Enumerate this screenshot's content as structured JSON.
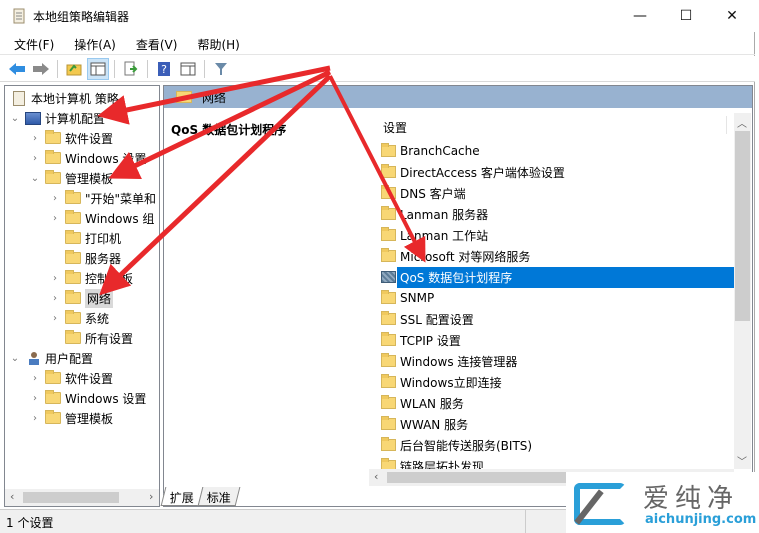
{
  "window": {
    "title": "本地组策略编辑器",
    "controls": {
      "minimize": "—",
      "maximize": "☐",
      "close": "✕"
    }
  },
  "menubar": {
    "items": [
      "文件(F)",
      "操作(A)",
      "查看(V)",
      "帮助(H)"
    ]
  },
  "toolbar": {
    "buttons": [
      "back-icon",
      "forward-icon",
      "up-folder-icon",
      "show-hide-tree-icon",
      "export-list-icon",
      "help-icon",
      "show-action-pane-icon",
      "filter-icon"
    ]
  },
  "tree": {
    "root": "本地计算机 策略",
    "computer_config": "计算机配置",
    "software_settings": "软件设置",
    "windows_settings": "Windows 设置",
    "admin_templates": "管理模板",
    "start_menu": "\"开始\"菜单和",
    "windows_components": "Windows 组",
    "printers": "打印机",
    "server": "服务器",
    "control_panel": "控制面板",
    "network": "网络",
    "system": "系统",
    "all_settings": "所有设置",
    "user_config": "用户配置",
    "user_software_settings": "软件设置",
    "user_windows_settings": "Windows 设置",
    "user_admin_templates": "管理模板"
  },
  "right_pane": {
    "header": "网络",
    "description_title": "QoS 数据包计划程序",
    "column_header": "设置",
    "items": [
      {
        "label": "BranchCache",
        "type": "folder"
      },
      {
        "label": "DirectAccess 客户端体验设置",
        "type": "folder"
      },
      {
        "label": "DNS 客户端",
        "type": "folder"
      },
      {
        "label": "Lanman 服务器",
        "type": "folder"
      },
      {
        "label": "Lanman 工作站",
        "type": "folder"
      },
      {
        "label": "Microsoft 对等网络服务",
        "type": "folder"
      },
      {
        "label": "QoS 数据包计划程序",
        "type": "policy",
        "selected": true
      },
      {
        "label": "SNMP",
        "type": "folder"
      },
      {
        "label": "SSL 配置设置",
        "type": "folder"
      },
      {
        "label": "TCPIP 设置",
        "type": "folder"
      },
      {
        "label": "Windows 连接管理器",
        "type": "folder"
      },
      {
        "label": "Windows立即连接",
        "type": "folder"
      },
      {
        "label": "WLAN 服务",
        "type": "folder"
      },
      {
        "label": "WWAN 服务",
        "type": "folder"
      },
      {
        "label": "后台智能传送服务(BITS)",
        "type": "folder"
      },
      {
        "label": "链路层拓扑发现",
        "type": "folder"
      }
    ]
  },
  "tabs": [
    "扩展",
    "标准"
  ],
  "statusbar": {
    "text": "1 个设置"
  },
  "watermark": {
    "cn": "爱纯净",
    "en": "aichunjing.com"
  },
  "colors": {
    "selection": "#0078d7",
    "header_band": "#98b2d0",
    "annotation_arrow": "#e8292b"
  }
}
